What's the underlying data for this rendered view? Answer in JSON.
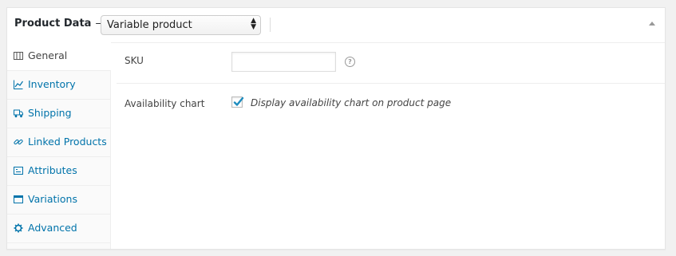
{
  "header": {
    "title": "Product Data",
    "separator": "—",
    "product_type": "Variable product"
  },
  "tabs": [
    {
      "label": "General",
      "icon": "table-icon",
      "active": true
    },
    {
      "label": "Inventory",
      "icon": "chart-line-icon",
      "active": false
    },
    {
      "label": "Shipping",
      "icon": "truck-icon",
      "active": false
    },
    {
      "label": "Linked Products",
      "icon": "link-icon",
      "active": false
    },
    {
      "label": "Attributes",
      "icon": "list-icon",
      "active": false
    },
    {
      "label": "Variations",
      "icon": "window-icon",
      "active": false
    },
    {
      "label": "Advanced",
      "icon": "gear-icon",
      "active": false
    }
  ],
  "fields": {
    "sku": {
      "label": "SKU",
      "value": "",
      "help": "?"
    },
    "availability": {
      "label": "Availability chart",
      "checked": true,
      "description": "Display availability chart on product page"
    }
  },
  "colors": {
    "link": "#0073aa",
    "checkmark": "#1e8cbe",
    "panel_bg": "#ffffff",
    "page_bg": "#f1f1f1"
  }
}
